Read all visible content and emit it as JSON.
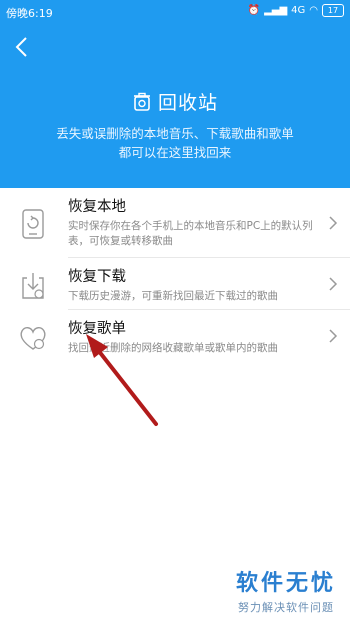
{
  "status_bar": {
    "time": "傍晚6:19",
    "network": "4G",
    "battery": "17"
  },
  "header": {
    "title": "回收站",
    "subtitle_line1": "丢失或误删除的本地音乐、下载歌曲和歌单",
    "subtitle_line2": "都可以在这里找回来"
  },
  "items": [
    {
      "icon": "phone-restore-icon",
      "label": "恢复本地",
      "desc": "实时保存你在各个手机上的本地音乐和PC上的默认列表，可恢复或转移歌曲"
    },
    {
      "icon": "download-restore-icon",
      "label": "恢复下载",
      "desc": "下载历史漫游，可重新找回最近下载过的歌曲"
    },
    {
      "icon": "heart-restore-icon",
      "label": "恢复歌单",
      "desc": "找回最近删除的网络收藏歌单或歌单内的歌曲"
    }
  ],
  "watermark": {
    "title": "软件无忧",
    "subtitle": "努力解决软件问题"
  },
  "colors": {
    "header_bg": "#1f9bf0",
    "arrow": "#b11b1b",
    "watermark": "#2a7fd0"
  }
}
